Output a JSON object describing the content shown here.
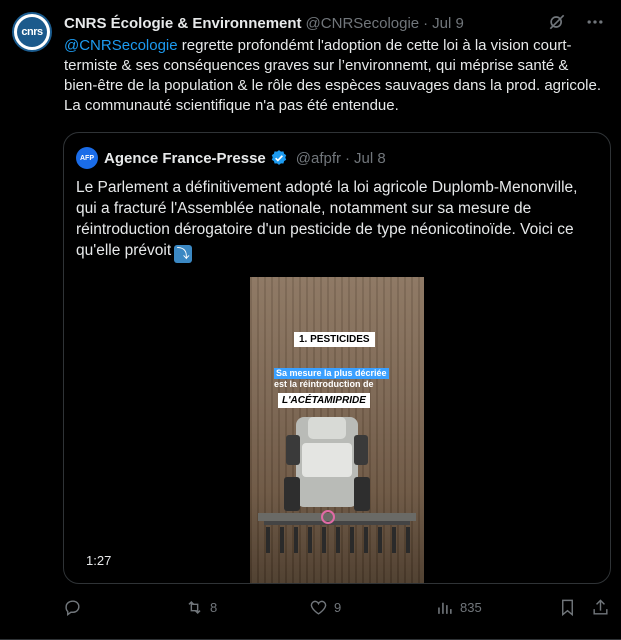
{
  "tweet": {
    "author_name": "CNRS Écologie & Environnement",
    "author_handle": "@CNRSecologie",
    "separator": "·",
    "date": "Jul 9",
    "avatar_text": "cnrs",
    "mention": "@CNRSecologie",
    "body": " regrette profondémt l'adoption de cette loi à la vision court-termiste & ses conséquences graves sur l’environnemt, qui méprise santé & bien-être de la population & le rôle des espèces sauvages dans la prod. agricole. La communauté scientifique n'a pas été entendue."
  },
  "quote": {
    "author_name": "Agence France-Presse",
    "author_handle": "@afpfr",
    "separator": "·",
    "date": "Jul 8",
    "avatar_text": "AFP",
    "body": "Le Parlement a définitivement adopté la loi agricole Duplomb-Menonville, qui a fracturé l'Assemblée nationale, notamment sur sa mesure de réintroduction dérogatoire d'un pesticide de type néonicotinoïde. Voici ce qu'elle prévoit",
    "emoji": "⤵",
    "video": {
      "title_tag": "1. PESTICIDES",
      "line1": "Sa mesure la plus décriée",
      "line2": "est la réintroduction de",
      "highlight": "L'ACÉTAMIPRIDE",
      "duration": "1:27"
    }
  },
  "actions": {
    "replies": "",
    "reposts": "8",
    "likes": "9",
    "views": "835"
  },
  "colors": {
    "background": "#000000",
    "text": "#e7e9ea",
    "secondary": "#71767b",
    "link": "#1d9bf0",
    "border": "#2f3336"
  }
}
